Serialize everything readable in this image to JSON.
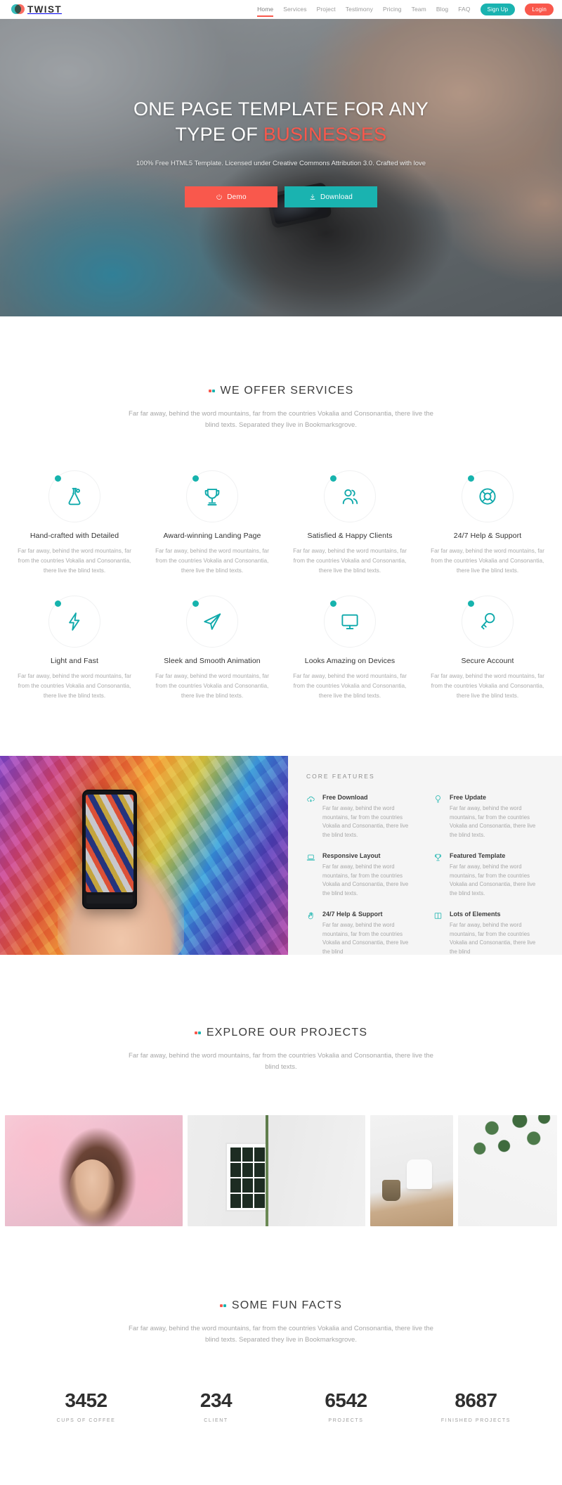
{
  "brand": {
    "name": "TWIST",
    "logo_icon": "twist-circles-logo",
    "teal": "#1ab3b0",
    "red": "#f9584c"
  },
  "nav": {
    "links": [
      {
        "label": "Home",
        "active": true
      },
      {
        "label": "Services",
        "active": false
      },
      {
        "label": "Project",
        "active": false
      },
      {
        "label": "Testimony",
        "active": false
      },
      {
        "label": "Pricing",
        "active": false
      },
      {
        "label": "Team",
        "active": false
      },
      {
        "label": "Blog",
        "active": false
      },
      {
        "label": "FAQ",
        "active": false
      }
    ],
    "signup_label": "Sign Up",
    "login_label": "Login"
  },
  "hero": {
    "title_line1": "ONE PAGE TEMPLATE FOR ANY",
    "title_line2_plain": "TYPE OF ",
    "title_line2_accent": "BUSINESSES",
    "subtitle": "100% Free HTML5 Template. Licensed under Creative Commons Attribution 3.0. Crafted with love",
    "demo_label": "Demo",
    "download_label": "Download",
    "demo_icon": "power-icon",
    "download_icon": "download-icon"
  },
  "services": {
    "title": "WE OFFER SERVICES",
    "subtitle": "Far far away, behind the word mountains, far from the countries Vokalia and Consonantia, there live the blind texts. Separated they live in Bookmarksgrove.",
    "items": [
      {
        "icon": "flask-icon",
        "title": "Hand-crafted with Detailed",
        "text": "Far far away, behind the word mountains, far from the countries Vokalia and Consonantia, there live the blind texts."
      },
      {
        "icon": "trophy-icon",
        "title": "Award-winning Landing Page",
        "text": "Far far away, behind the word mountains, far from the countries Vokalia and Consonantia, there live the blind texts."
      },
      {
        "icon": "users-icon",
        "title": "Satisfied & Happy Clients",
        "text": "Far far away, behind the word mountains, far from the countries Vokalia and Consonantia, there live the blind texts."
      },
      {
        "icon": "lifebuoy-icon",
        "title": "24/7 Help & Support",
        "text": "Far far away, behind the word mountains, far from the countries Vokalia and Consonantia, there live the blind texts."
      },
      {
        "icon": "bolt-icon",
        "title": "Light and Fast",
        "text": "Far far away, behind the word mountains, far from the countries Vokalia and Consonantia, there live the blind texts."
      },
      {
        "icon": "paper-plane-icon",
        "title": "Sleek and Smooth Animation",
        "text": "Far far away, behind the word mountains, far from the countries Vokalia and Consonantia, there live the blind texts."
      },
      {
        "icon": "monitor-icon",
        "title": "Looks Amazing on Devices",
        "text": "Far far away, behind the word mountains, far from the countries Vokalia and Consonantia, there live the blind texts."
      },
      {
        "icon": "key-icon",
        "title": "Secure Account",
        "text": "Far far away, behind the word mountains, far from the countries Vokalia and Consonantia, there live the blind texts."
      }
    ]
  },
  "core_features": {
    "heading": "CORE FEATURES",
    "items": [
      {
        "icon": "cloud-download-icon",
        "title": "Free Download",
        "text": "Far far away, behind the word mountains, far from the countries Vokalia and Consonantia, there live the blind texts."
      },
      {
        "icon": "lightbulb-icon",
        "title": "Free Update",
        "text": "Far far away, behind the word mountains, far from the countries Vokalia and Consonantia, there live the blind texts."
      },
      {
        "icon": "laptop-icon",
        "title": "Responsive Layout",
        "text": "Far far away, behind the word mountains, far from the countries Vokalia and Consonantia, there live the blind texts."
      },
      {
        "icon": "trophy-icon",
        "title": "Featured Template",
        "text": "Far far away, behind the word mountains, far from the countries Vokalia and Consonantia, there live the blind texts."
      },
      {
        "icon": "hand-icon",
        "title": "24/7 Help & Support",
        "text": "Far far away, behind the word mountains, far from the countries Vokalia and Consonantia, there live the blind"
      },
      {
        "icon": "columns-icon",
        "title": "Lots of Elements",
        "text": "Far far away, behind the word mountains, far from the countries Vokalia and Consonantia, there live the blind"
      }
    ]
  },
  "projects": {
    "title": "EXPLORE OUR PROJECTS",
    "subtitle": "Far far away, behind the word mountains, far from the countries Vokalia and Consonantia, there live the blind texts.",
    "items": [
      {
        "name": "project-woman-in-blossom"
      },
      {
        "name": "project-tree-by-window"
      },
      {
        "name": "project-chair-and-basket"
      },
      {
        "name": "project-eucalyptus-branch"
      }
    ]
  },
  "fun_facts": {
    "title": "SOME FUN FACTS",
    "subtitle": "Far far away, behind the word mountains, far from the countries Vokalia and Consonantia, there live the blind texts. Separated they live in Bookmarksgrove.",
    "counters": [
      {
        "value": "3452",
        "label": "CUPS OF COFFEE"
      },
      {
        "value": "234",
        "label": "CLIENT"
      },
      {
        "value": "6542",
        "label": "PROJECTS"
      },
      {
        "value": "8687",
        "label": "FINISHED PROJECTS"
      }
    ]
  }
}
